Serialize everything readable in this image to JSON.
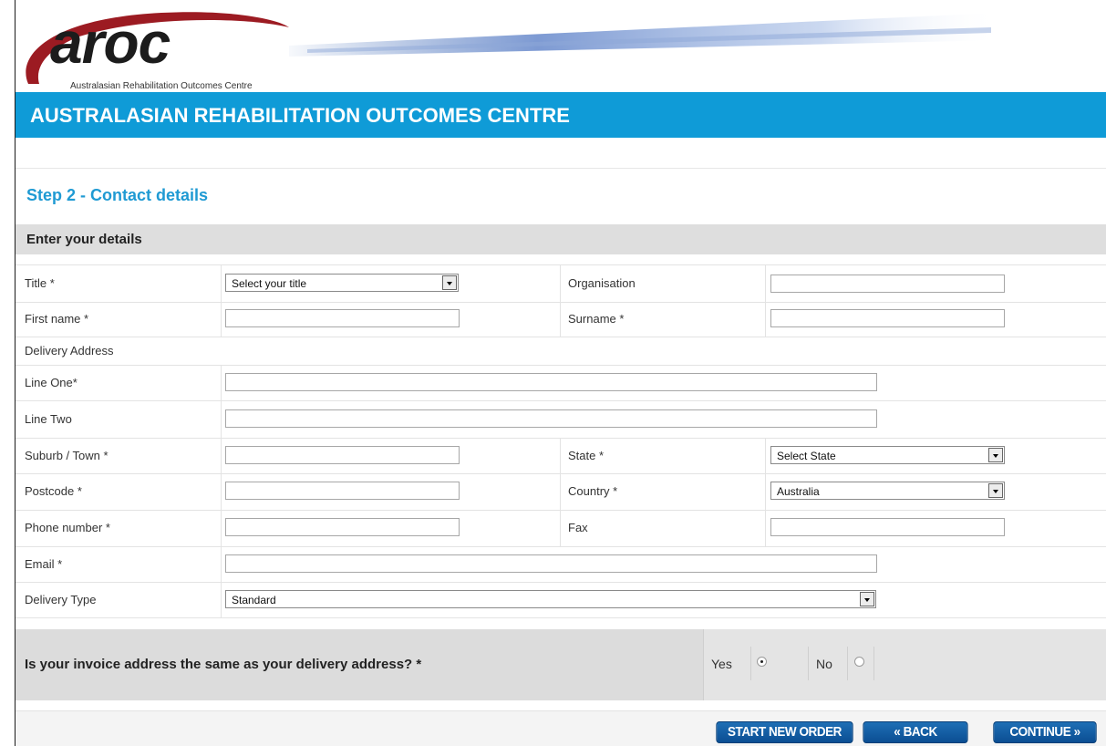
{
  "brand": {
    "logo_text": "aroc",
    "logo_subtitle": "Australasian Rehabilitation Outcomes Centre",
    "banner_title": "AUSTRALASIAN REHABILITATION OUTCOMES CENTRE",
    "banner_color": "#0f9bd7"
  },
  "page": {
    "step_title": "Step 2 - Contact details",
    "section_label": "Enter your details"
  },
  "form": {
    "title_label": "Title *",
    "title_select": "Select your title",
    "organisation_label": "Organisation",
    "organisation_value": "",
    "first_name_label": "First name *",
    "first_name_value": "",
    "surname_label": "Surname *",
    "surname_value": "",
    "delivery_address_label": "Delivery Address",
    "line_one_label": "Line One*",
    "line_one_value": "",
    "line_two_label": "Line Two",
    "line_two_value": "",
    "suburb_label": "Suburb / Town *",
    "suburb_value": "",
    "state_label": "State *",
    "state_select": "Select State",
    "postcode_label": "Postcode *",
    "postcode_value": "",
    "country_label": "Country *",
    "country_select": "Australia",
    "phone_label": "Phone number *",
    "phone_value": "",
    "fax_label": "Fax",
    "fax_value": "",
    "email_label": "Email *",
    "email_value": "",
    "delivery_type_label": "Delivery Type",
    "delivery_type_select": "Standard"
  },
  "question": {
    "text": "Is your invoice address the same as your delivery address? *",
    "yes_label": "Yes",
    "no_label": "No",
    "selected": "Yes"
  },
  "buttons": {
    "start_new_order": "START NEW ORDER",
    "back": "« BACK",
    "continue": "CONTINUE »",
    "color": "#0b4e93"
  }
}
